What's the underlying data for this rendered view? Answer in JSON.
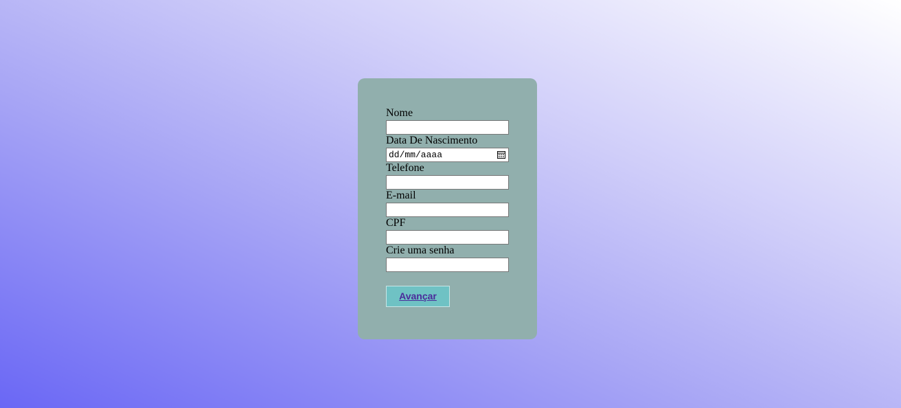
{
  "colors": {
    "card_background": "#91afad",
    "button_background": "#6fc2c4",
    "button_text": "#4b2b9a",
    "gradient_start": "#6a67f5",
    "gradient_end": "#ffffff"
  },
  "form": {
    "name_label": "Nome",
    "name_value": "",
    "birthdate_label": "Data De Nascimento",
    "birthdate_placeholder": "dd/mm/aaaa",
    "phone_label": "Telefone",
    "phone_value": "",
    "email_label": "E-mail",
    "email_value": "",
    "cpf_label": "CPF",
    "cpf_value": "",
    "password_label": "Crie uma senha",
    "password_value": "",
    "submit_label": "Avançar",
    "calendar_icon": "calendar-icon"
  }
}
